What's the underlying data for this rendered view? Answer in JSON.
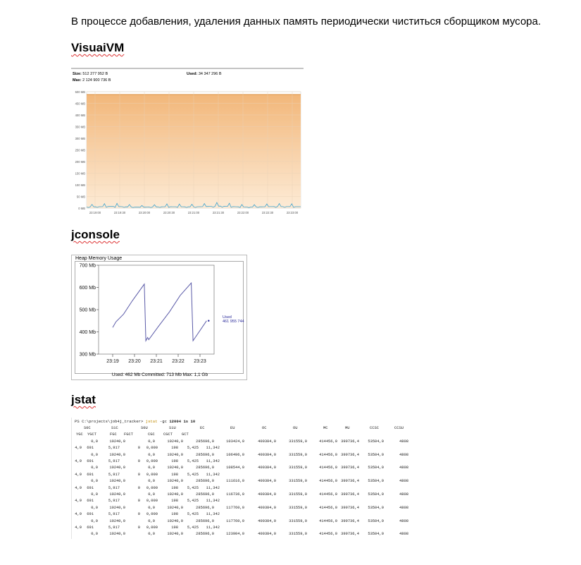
{
  "paragraph": "В процессе добавления, удаления данных память периодически  чиститься сборщиком мусора.",
  "sections": {
    "visualvm_heading": "VisuaiVM",
    "jconsole_heading": "jconsole",
    "jstat_heading": "jstat"
  },
  "visualvm": {
    "size_label": "Size:",
    "size_value": "512 277 952 B",
    "used_label": "Used:",
    "used_value": "34 347 296 B",
    "max_label": "Max:",
    "max_value": "2 124 900 736 B",
    "y_ticks": [
      "500 MB",
      "450 MB",
      "400 MB",
      "350 MB",
      "300 MB",
      "250 MB",
      "200 MB",
      "150 MB",
      "100 MB",
      "50 MB",
      "0 MB"
    ],
    "x_ticks": [
      "23:19:00",
      "23:19:30",
      "23:20:00",
      "23:20:30",
      "23:21:00",
      "23:21:30",
      "23:22:00",
      "23:22:30",
      "23:23:00"
    ],
    "colors": {
      "heap_fill_top": "#f2b77a",
      "heap_fill_bottom": "#fdebd6",
      "used_line": "#3ba3d0"
    }
  },
  "jconsole": {
    "panel_title": "Heap Memory Usage",
    "y_ticks": [
      "700 Mb",
      "600 Mb",
      "500 Mb",
      "400 Mb",
      "300 Mb"
    ],
    "x_ticks": [
      "23:19",
      "23:20",
      "23:21",
      "23:22",
      "23:23"
    ],
    "legend_label": "Used",
    "legend_value": "461 955 744",
    "footer": "Used: 462 Mb    Committed: 713 Mb    Max: 1,1 Gb",
    "colors": {
      "line": "#5b5ba8",
      "legend": "#2a2a9a"
    }
  },
  "jstat": {
    "prompt": "PS C:\\projects\\job4j_tracker> ",
    "command": "jstat",
    "args": " -gc ",
    "args_bold": "12004 1s 10",
    "header1": [
      "S0C",
      "S1C",
      "S0U",
      "S1U",
      "EC",
      "EU",
      "OC",
      "OU",
      "MC",
      "MU",
      "CCSC",
      "CCSU"
    ],
    "header2": [
      "YGC",
      "YGCT",
      "FGC",
      "FGCT",
      "CGC",
      "CGCT",
      "GCT"
    ],
    "rows": [
      {
        "a": [
          "0,0",
          "10240,0",
          "0,0",
          "10240,0",
          "285696,0",
          "103424,0",
          "400384,0",
          "331559,0",
          "414456,0",
          "399736,4",
          "53504,0",
          "4808"
        ],
        "b": [
          "4,9",
          "691",
          "5,917",
          "0",
          "0,000",
          "198",
          "5,425",
          "11,342"
        ]
      },
      {
        "a": [
          "0,0",
          "10240,0",
          "0,0",
          "10240,0",
          "285696,0",
          "106496,0",
          "400384,0",
          "331559,0",
          "414456,0",
          "399736,4",
          "53504,0",
          "4808"
        ],
        "b": [
          "4,9",
          "691",
          "5,917",
          "0",
          "0,000",
          "198",
          "5,425",
          "11,342"
        ]
      },
      {
        "a": [
          "0,0",
          "10240,0",
          "0,0",
          "10240,0",
          "285696,0",
          "108544,0",
          "400384,0",
          "331559,0",
          "414456,0",
          "399736,4",
          "53504,0",
          "4808"
        ],
        "b": [
          "4,9",
          "691",
          "5,917",
          "0",
          "0,000",
          "198",
          "5,425",
          "11,342"
        ]
      },
      {
        "a": [
          "0,0",
          "10240,0",
          "0,0",
          "10240,0",
          "285696,0",
          "111616,0",
          "400384,0",
          "331559,0",
          "414456,0",
          "399736,4",
          "53504,0",
          "4808"
        ],
        "b": [
          "4,9",
          "691",
          "5,917",
          "0",
          "0,000",
          "198",
          "5,425",
          "11,342"
        ]
      },
      {
        "a": [
          "0,0",
          "10240,0",
          "0,0",
          "10240,0",
          "285696,0",
          "116736,0",
          "400384,0",
          "331559,0",
          "414456,0",
          "399736,4",
          "53504,0",
          "4808"
        ],
        "b": [
          "4,9",
          "691",
          "5,917",
          "0",
          "0,000",
          "198",
          "5,425",
          "11,342"
        ]
      },
      {
        "a": [
          "0,0",
          "10240,0",
          "0,0",
          "10240,0",
          "285696,0",
          "117760,0",
          "400384,0",
          "331559,0",
          "414456,0",
          "399736,4",
          "53504,0",
          "4808"
        ],
        "b": [
          "4,9",
          "691",
          "5,917",
          "0",
          "0,000",
          "198",
          "5,425",
          "11,342"
        ]
      },
      {
        "a": [
          "0,0",
          "10240,0",
          "0,0",
          "10240,0",
          "285696,0",
          "117760,0",
          "400384,0",
          "331559,0",
          "414456,0",
          "399736,4",
          "53504,0",
          "4808"
        ],
        "b": [
          "4,9",
          "691",
          "5,917",
          "0",
          "0,000",
          "198",
          "5,425",
          "11,342"
        ]
      },
      {
        "a": [
          "0,0",
          "10240,0",
          "0,0",
          "10240,0",
          "285696,0",
          "123904,0",
          "400384,0",
          "331559,0",
          "414456,0",
          "399736,4",
          "53504,0",
          "4808"
        ],
        "b": null
      }
    ]
  },
  "chart_data": [
    {
      "type": "area",
      "xlabel": "",
      "ylabel": "",
      "y_ticks": [
        "0 MB",
        "50 MB",
        "100 MB",
        "150 MB",
        "200 MB",
        "250 MB",
        "300 MB",
        "350 MB",
        "400 MB",
        "450 MB",
        "500 MB"
      ],
      "x": [
        "23:19:00",
        "23:19:30",
        "23:20:00",
        "23:20:30",
        "23:21:00",
        "23:21:30",
        "23:22:00",
        "23:22:30",
        "23:23:00"
      ],
      "ylim": [
        0,
        500
      ],
      "series": [
        {
          "name": "Size",
          "values": [
            488,
            488,
            488,
            488,
            488,
            488,
            488,
            488,
            488
          ]
        },
        {
          "name": "Used",
          "values": [
            8,
            12,
            6,
            10,
            9,
            14,
            7,
            11,
            10
          ]
        }
      ]
    },
    {
      "type": "line",
      "title": "Heap Memory Usage",
      "x": [
        "23:19",
        "23:20",
        "23:21",
        "23:22",
        "23:23"
      ],
      "ylim": [
        300,
        700
      ],
      "series": [
        {
          "name": "Used",
          "points": [
            [
              0.0,
              420
            ],
            [
              0.15,
              445
            ],
            [
              0.5,
              480
            ],
            [
              0.9,
              540
            ],
            [
              1.45,
              615
            ],
            [
              1.52,
              360
            ],
            [
              1.6,
              375
            ],
            [
              1.65,
              365
            ],
            [
              2.1,
              425
            ],
            [
              2.6,
              490
            ],
            [
              3.1,
              565
            ],
            [
              3.6,
              620
            ],
            [
              3.68,
              360
            ],
            [
              4.3,
              450
            ]
          ]
        }
      ]
    }
  ]
}
